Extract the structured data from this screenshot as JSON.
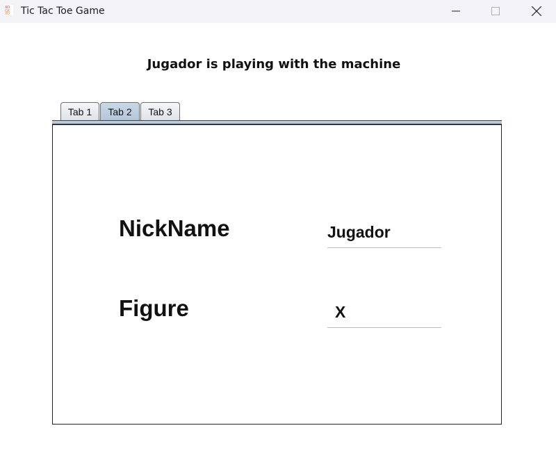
{
  "window": {
    "title": "Tic Tac Toe Game",
    "controls": {
      "minimize": "minimize-icon",
      "maximize": "maximize-icon",
      "close": "close-icon"
    }
  },
  "header": {
    "title": "Jugador is playing with the machine"
  },
  "tabs": [
    {
      "label": "Tab 1",
      "selected": false
    },
    {
      "label": "Tab 2",
      "selected": true
    },
    {
      "label": "Tab 3",
      "selected": false
    }
  ],
  "form": {
    "nickname_label": "NickName",
    "nickname_value": "Jugador",
    "figure_label": "Figure",
    "figure_value": "X"
  },
  "colors": {
    "selected_tab": "#b3c6d8",
    "tab_strip": "#bdcbd9"
  }
}
